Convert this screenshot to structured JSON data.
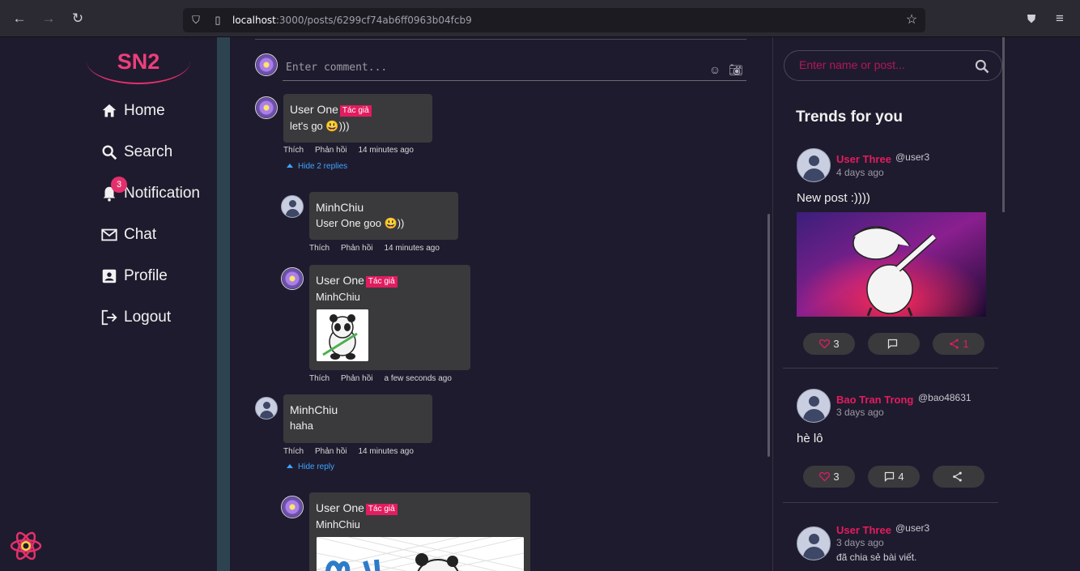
{
  "browser": {
    "url_host": "localhost",
    "url_path": ":3000/posts/6299cf74ab6ff0963b04fcb9"
  },
  "sidebar": {
    "logo": "SN2",
    "items": [
      {
        "label": "Home",
        "icon": "home-icon"
      },
      {
        "label": "Search",
        "icon": "search-icon"
      },
      {
        "label": "Notification",
        "icon": "bell-icon",
        "badge": "3"
      },
      {
        "label": "Chat",
        "icon": "mail-icon"
      },
      {
        "label": "Profile",
        "icon": "profile-icon"
      },
      {
        "label": "Logout",
        "icon": "logout-icon"
      }
    ]
  },
  "comments": {
    "placeholder": "Enter comment...",
    "author_tag": "Tác giả",
    "like": "Thích",
    "reply": "Phản hồi",
    "list": [
      {
        "name": "User One",
        "text": "let's go 😃)))",
        "time": "14 minutes ago",
        "toggle": "Hide 2 replies"
      },
      {
        "name": "MinhChiu",
        "text": "User One goo 😃))",
        "time": "14 minutes ago"
      },
      {
        "name": "User One",
        "text": "MinhChiu",
        "time": "a few seconds ago"
      },
      {
        "name": "MinhChiu",
        "text": "haha",
        "time": "14 minutes ago",
        "toggle": "Hide reply"
      },
      {
        "name": "User One",
        "text": "MinhChiu"
      }
    ]
  },
  "right": {
    "search_placeholder": "Enter name or post...",
    "trends_title": "Trends for you",
    "posts": [
      {
        "name": "User Three",
        "handle": "@user3",
        "time": "4 days ago",
        "text": "New post :))))",
        "likes": "3",
        "comments": "",
        "shares": "1"
      },
      {
        "name": "Bao Tran Trong",
        "handle": "@bao48631",
        "time": "3 days ago",
        "text": "hè lô",
        "likes": "3",
        "comments": "4",
        "shares": ""
      },
      {
        "name": "User Three",
        "handle": "@user3",
        "time": "3 days ago",
        "text": "đã chia sẻ bài viết."
      }
    ]
  },
  "colors": {
    "accent": "#e31c5f",
    "background": "#1f1b2e",
    "bubble": "#3a3a3d",
    "link": "#3ba6ff"
  }
}
